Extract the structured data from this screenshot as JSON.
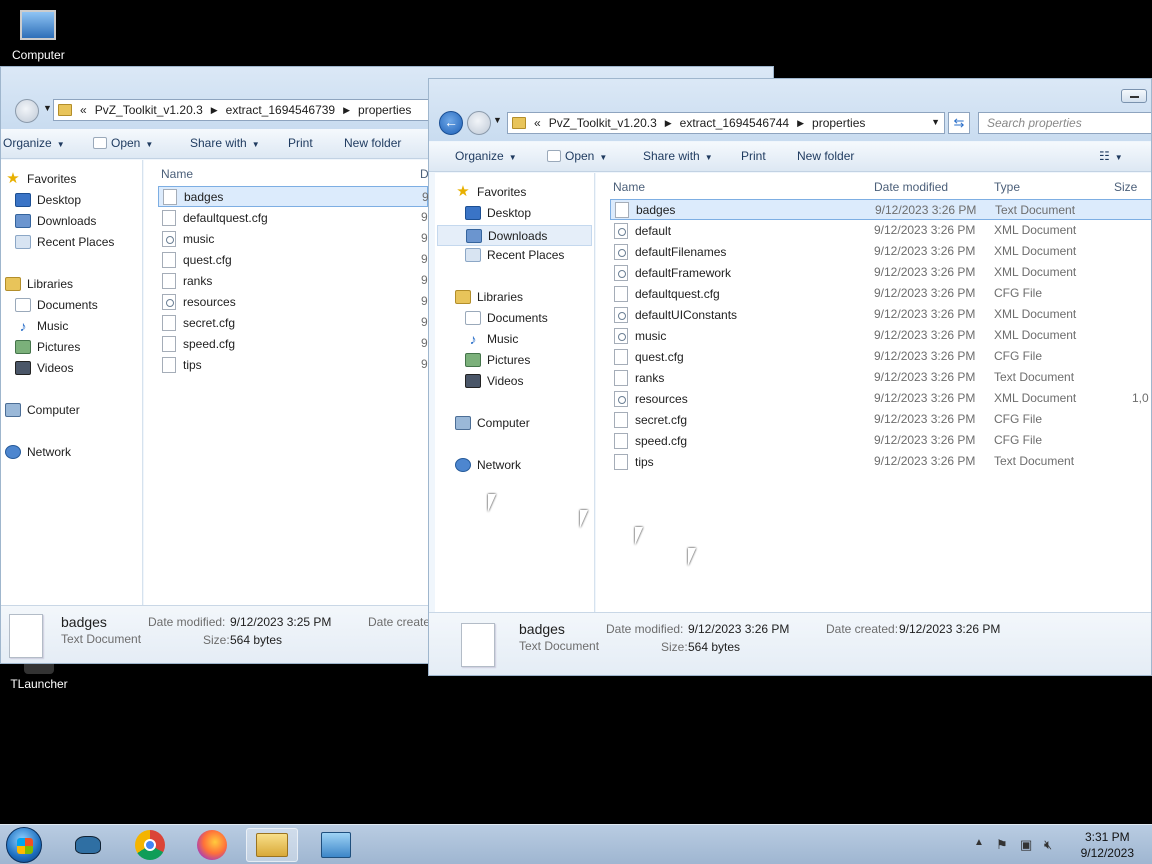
{
  "desktop": {
    "icons": [
      {
        "label": "Computer"
      },
      {
        "label": "TLauncher"
      }
    ]
  },
  "back_window": {
    "breadcrumb": [
      "PvZ_Toolkit_v1.20.3",
      "extract_1694546739",
      "properties"
    ],
    "toolbar": {
      "organize": "Organize",
      "open": "Open",
      "share_with": "Share with",
      "print": "Print",
      "new_folder": "New folder"
    },
    "nav": {
      "favorites": "Favorites",
      "desktop": "Desktop",
      "downloads": "Downloads",
      "recent_places": "Recent Places",
      "libraries": "Libraries",
      "documents": "Documents",
      "music": "Music",
      "pictures": "Pictures",
      "videos": "Videos",
      "computer": "Computer",
      "network": "Network"
    },
    "columns": {
      "name": "Name",
      "date": "D"
    },
    "files": [
      {
        "name": "badges",
        "type": "txt",
        "date": "9"
      },
      {
        "name": "defaultquest.cfg",
        "type": "txt",
        "date": "9"
      },
      {
        "name": "music",
        "type": "xml",
        "date": "9"
      },
      {
        "name": "quest.cfg",
        "type": "txt",
        "date": "9"
      },
      {
        "name": "ranks",
        "type": "txt",
        "date": "9"
      },
      {
        "name": "resources",
        "type": "xml",
        "date": "9"
      },
      {
        "name": "secret.cfg",
        "type": "txt",
        "date": "9"
      },
      {
        "name": "speed.cfg",
        "type": "txt",
        "date": "9"
      },
      {
        "name": "tips",
        "type": "txt",
        "date": "9"
      }
    ],
    "details": {
      "name": "badges",
      "type": "Text Document",
      "modified_label": "Date modified:",
      "modified": "9/12/2023 3:25 PM",
      "size_label": "Size:",
      "size": "564 bytes",
      "created_label": "Date create"
    }
  },
  "front_window": {
    "breadcrumb": [
      "PvZ_Toolkit_v1.20.3",
      "extract_1694546744",
      "properties"
    ],
    "search_placeholder": "Search properties",
    "toolbar": {
      "organize": "Organize",
      "open": "Open",
      "share_with": "Share with",
      "print": "Print",
      "new_folder": "New folder"
    },
    "nav": {
      "favorites": "Favorites",
      "desktop": "Desktop",
      "downloads": "Downloads",
      "recent_places": "Recent Places",
      "libraries": "Libraries",
      "documents": "Documents",
      "music": "Music",
      "pictures": "Pictures",
      "videos": "Videos",
      "computer": "Computer",
      "network": "Network"
    },
    "columns": {
      "name": "Name",
      "date": "Date modified",
      "type": "Type",
      "size": "Size"
    },
    "files": [
      {
        "name": "badges",
        "date": "9/12/2023 3:26 PM",
        "type": "Text Document",
        "size": ""
      },
      {
        "name": "default",
        "date": "9/12/2023 3:26 PM",
        "type": "XML Document",
        "size": ""
      },
      {
        "name": "defaultFilenames",
        "date": "9/12/2023 3:26 PM",
        "type": "XML Document",
        "size": ""
      },
      {
        "name": "defaultFramework",
        "date": "9/12/2023 3:26 PM",
        "type": "XML Document",
        "size": ""
      },
      {
        "name": "defaultquest.cfg",
        "date": "9/12/2023 3:26 PM",
        "type": "CFG File",
        "size": ""
      },
      {
        "name": "defaultUIConstants",
        "date": "9/12/2023 3:26 PM",
        "type": "XML Document",
        "size": ""
      },
      {
        "name": "music",
        "date": "9/12/2023 3:26 PM",
        "type": "XML Document",
        "size": ""
      },
      {
        "name": "quest.cfg",
        "date": "9/12/2023 3:26 PM",
        "type": "CFG File",
        "size": ""
      },
      {
        "name": "ranks",
        "date": "9/12/2023 3:26 PM",
        "type": "Text Document",
        "size": ""
      },
      {
        "name": "resources",
        "date": "9/12/2023 3:26 PM",
        "type": "XML Document",
        "size": "1,0"
      },
      {
        "name": "secret.cfg",
        "date": "9/12/2023 3:26 PM",
        "type": "CFG File",
        "size": ""
      },
      {
        "name": "speed.cfg",
        "date": "9/12/2023 3:26 PM",
        "type": "CFG File",
        "size": ""
      },
      {
        "name": "tips",
        "date": "9/12/2023 3:26 PM",
        "type": "Text Document",
        "size": ""
      }
    ],
    "details": {
      "name": "badges",
      "type": "Text Document",
      "modified_label": "Date modified:",
      "modified": "9/12/2023 3:26 PM",
      "created_label": "Date created:",
      "created": "9/12/2023 3:26 PM",
      "size_label": "Size:",
      "size": "564 bytes"
    }
  },
  "taskbar": {
    "apps": [
      "start-orb",
      "tlauncher-icon",
      "chrome-icon",
      "firefox-icon",
      "explorer-icon",
      "control-panel-icon"
    ],
    "time": "3:31 PM",
    "date": "9/12/2023"
  }
}
